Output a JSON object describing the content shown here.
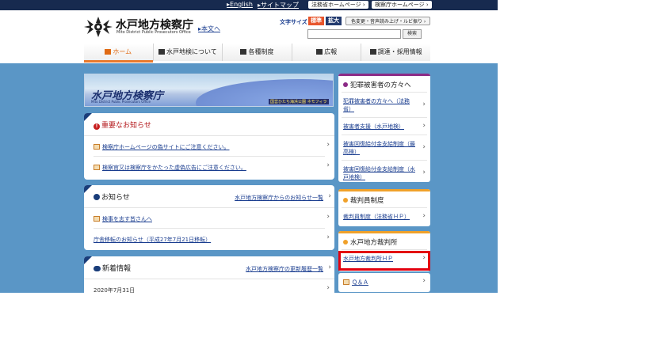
{
  "topbar": {
    "english": "English",
    "sitemap": "サイトマップ",
    "moj_home": "法務省ホームページ",
    "kensatsu_home": "検察庁ホームページ"
  },
  "header": {
    "logo_title": "水戸地方検察庁",
    "logo_subtitle": "Mito District Public Prosecutors Office",
    "skip_link": "本文へ",
    "font_size_label": "文字サイズ",
    "font_standard": "標準",
    "font_large": "拡大",
    "ruby_button": "色変更・音声読み上げ・ルビ振り",
    "search_placeholder": "",
    "search_button": "検索"
  },
  "nav": {
    "items": [
      {
        "label": "ホーム",
        "icon": "home-icon"
      },
      {
        "label": "水戸地検について",
        "icon": "building-icon"
      },
      {
        "label": "各種制度",
        "icon": "document-icon"
      },
      {
        "label": "広報",
        "icon": "megaphone-icon"
      },
      {
        "label": "調達・採用情報",
        "icon": "person-icon"
      }
    ]
  },
  "hero": {
    "title": "水戸地方検察庁",
    "subtitle": "Mito District Public Prosecutors Office",
    "note": "国営ひたち海浜公園 ネモフィラ"
  },
  "important": {
    "title": "重要なお知らせ",
    "items": [
      "検察庁ホームページの偽サイトにご注意ください。",
      "検察官又は検察庁をかたった虚偽広告にご注意ください。"
    ]
  },
  "notices": {
    "title": "お知らせ",
    "header_link": "水戸地方検察庁からのお知らせ一覧",
    "items": [
      "検事を志す皆さんへ",
      "庁舎移転のお知らせ（平成27年7月21日移転）"
    ]
  },
  "news": {
    "title": "新着情報",
    "header_link": "水戸地方検察庁の更新履歴一覧",
    "items": [
      "2020年7月31日"
    ]
  },
  "sidebar": {
    "victims": {
      "title": "犯罪被害者の方々へ",
      "items": [
        "犯罪被害者の方々へ（法務省）",
        "被害者支援（水戸地検）",
        "被害回復給付金支給制度（最高検）",
        "被害回復給付金支給制度（水戸地検）"
      ]
    },
    "saibanin": {
      "title": "裁判員制度",
      "items": [
        "裁判員制度（法務省ＨＰ）"
      ]
    },
    "court": {
      "title": "水戸地方裁判所",
      "items": [
        "水戸地方裁判所ＨＰ"
      ]
    },
    "qa": {
      "label": "Ｑ＆Ａ"
    }
  },
  "colors": {
    "topbar": "#172a4f",
    "accent_orange": "#e8792c",
    "background_blue": "#5a96c6",
    "victims_bar": "#8c2a86",
    "saibanin_bar": "#f0a12a",
    "highlight_red": "#e3000f"
  }
}
